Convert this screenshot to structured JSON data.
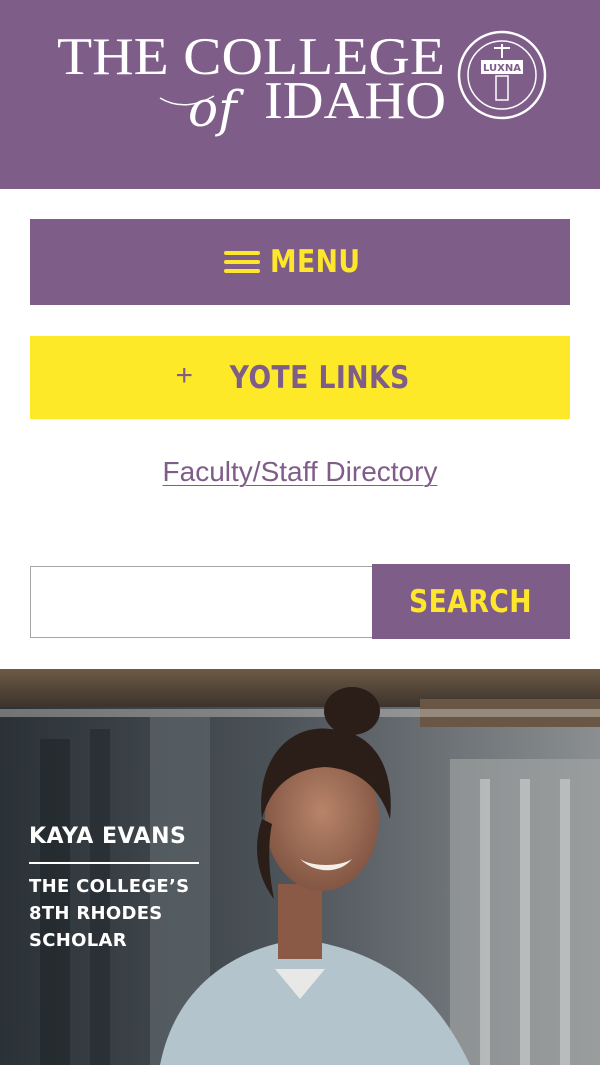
{
  "header": {
    "logo_line1": "THE COLLEGE",
    "logo_of": "of",
    "logo_line2": "IDAHO",
    "seal_text": "LUXNA",
    "background_color": "#7f5d89"
  },
  "menu": {
    "label": "MENU",
    "icon": "hamburger-icon"
  },
  "yote_links": {
    "label": "YOTE LINKS",
    "icon": "plus-icon"
  },
  "directory_link": {
    "label": "Faculty/Staff Directory"
  },
  "search": {
    "placeholder": "",
    "value": "",
    "button_label": "SEARCH"
  },
  "hero": {
    "name": "KAYA EVANS",
    "caption_lines": [
      "THE COLLEGE’S",
      "8TH RHODES",
      "SCHOLAR"
    ]
  },
  "colors": {
    "purple": "#7f5d89",
    "yellow": "#fde928",
    "white": "#ffffff"
  }
}
